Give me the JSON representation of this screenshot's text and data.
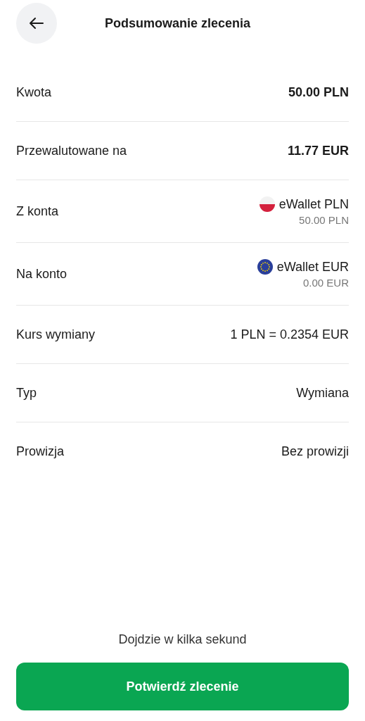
{
  "header": {
    "title": "Podsumowanie zlecenia"
  },
  "rows": [
    {
      "kind": "text",
      "label": "Kwota",
      "value": "50.00 PLN",
      "emphasis": true
    },
    {
      "kind": "text",
      "label": "Przewalutowane na",
      "value": "11.77 EUR",
      "emphasis": true
    },
    {
      "kind": "account",
      "label": "Z konta",
      "value": "eWallet PLN",
      "balance": "50.00 PLN",
      "flag": {
        "kind": "pl"
      }
    },
    {
      "kind": "account",
      "label": "Na konto",
      "value": "eWallet EUR",
      "balance": "0.00 EUR",
      "flag": {
        "kind": "eu"
      }
    },
    {
      "kind": "text",
      "label": "Kurs wymiany",
      "value": "1 PLN = 0.2354 EUR",
      "emphasis": false
    },
    {
      "kind": "text",
      "label": "Typ",
      "value": "Wymiana",
      "emphasis": false
    },
    {
      "kind": "text",
      "label": "Prowizja",
      "value": "Bez prowizji",
      "emphasis": false
    }
  ],
  "footer": {
    "note": "Dojdzie w kilka sekund",
    "button": "Potwierdź zlecenie"
  }
}
